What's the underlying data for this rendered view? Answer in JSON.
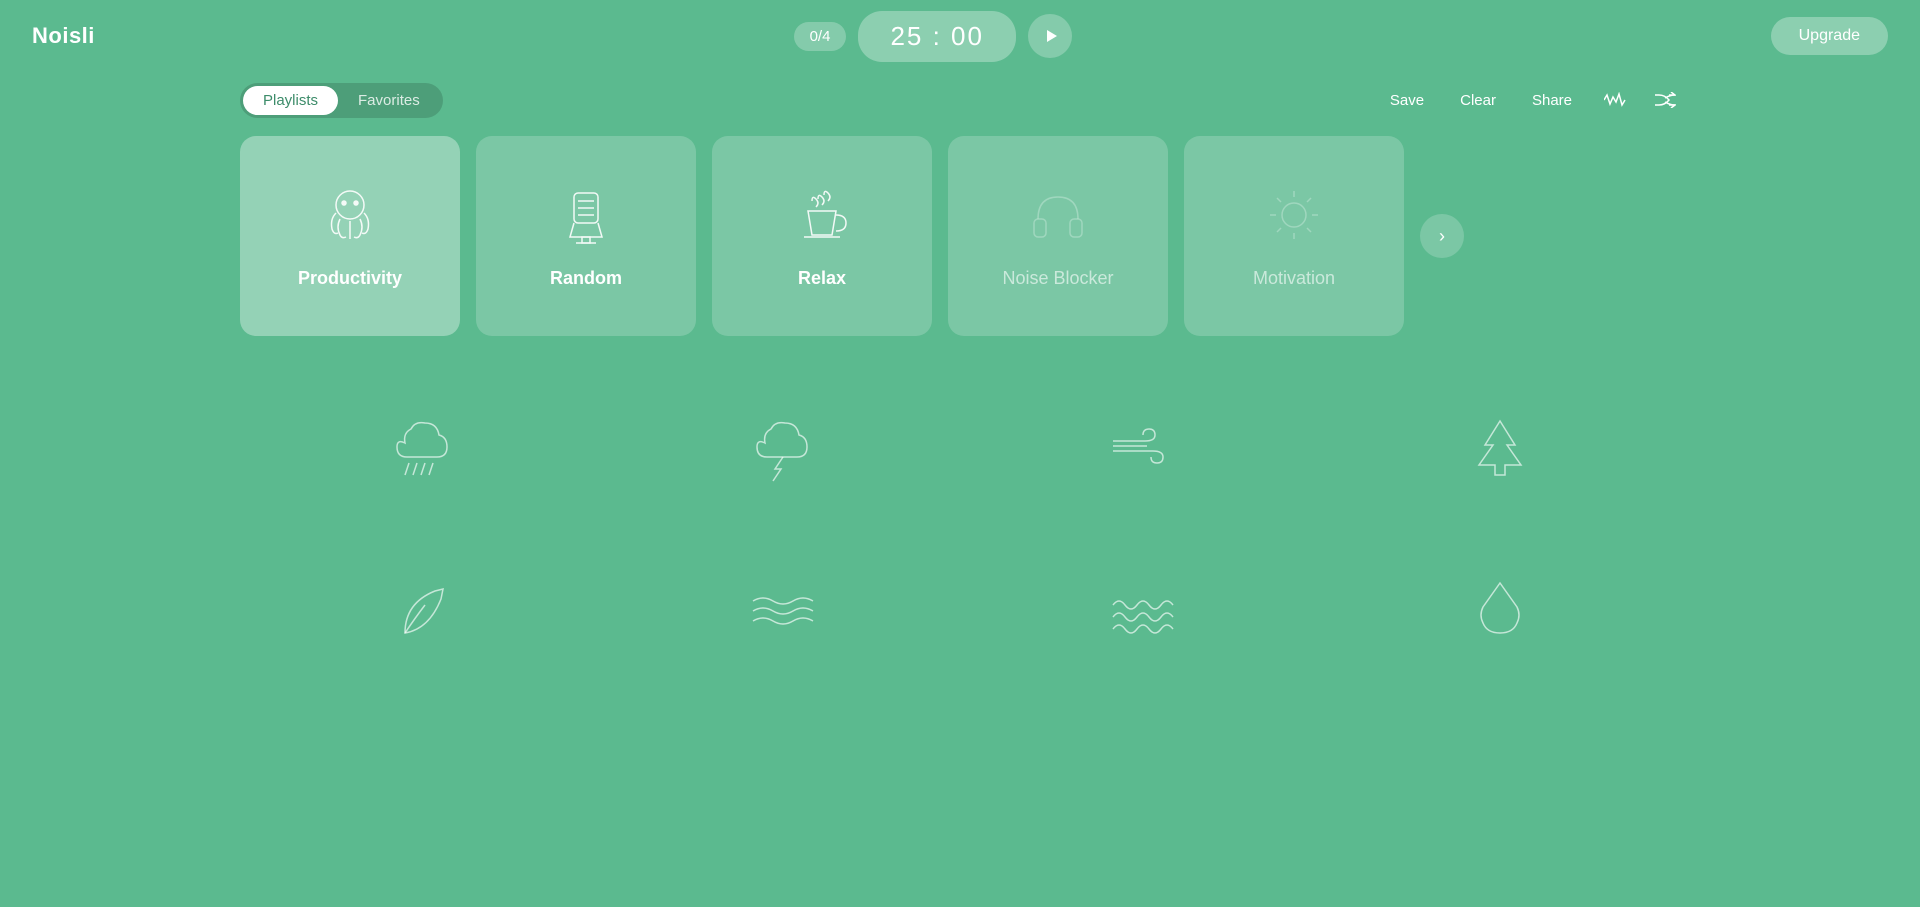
{
  "header": {
    "logo": "Noisli",
    "progress": "0/4",
    "timer": "25 : 00",
    "upgrade_label": "Upgrade"
  },
  "toolbar": {
    "tabs": [
      {
        "id": "playlists",
        "label": "Playlists",
        "active": true
      },
      {
        "id": "favorites",
        "label": "Favorites",
        "active": false
      }
    ],
    "save_label": "Save",
    "clear_label": "Clear",
    "share_label": "Share"
  },
  "playlists": [
    {
      "id": "productivity",
      "label": "Productivity",
      "active": true
    },
    {
      "id": "random",
      "label": "Random",
      "active": false
    },
    {
      "id": "relax",
      "label": "Relax",
      "active": false
    },
    {
      "id": "noise-blocker",
      "label": "Noise Blocker",
      "active": false,
      "muted": true
    },
    {
      "id": "motivation",
      "label": "Motivation",
      "active": false,
      "muted": true
    }
  ],
  "sounds": [
    {
      "id": "rain",
      "icon": "rain"
    },
    {
      "id": "thunder",
      "icon": "thunder"
    },
    {
      "id": "wind",
      "icon": "wind"
    },
    {
      "id": "forest",
      "icon": "forest"
    },
    {
      "id": "leaf",
      "icon": "leaf"
    },
    {
      "id": "waves-calm",
      "icon": "waves-calm"
    },
    {
      "id": "waves",
      "icon": "waves"
    },
    {
      "id": "drop",
      "icon": "drop"
    }
  ],
  "colors": {
    "bg": "#5bba8f",
    "card_active": "rgba(255,255,255,0.35)",
    "card_default": "rgba(255,255,255,0.2)"
  }
}
